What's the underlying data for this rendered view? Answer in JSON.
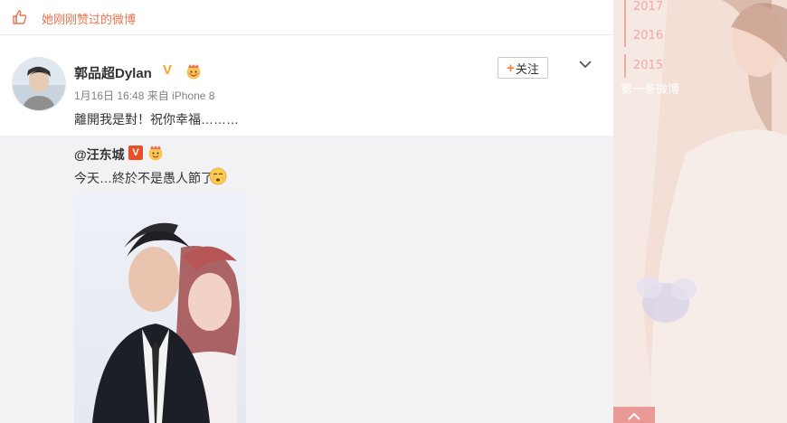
{
  "liked": {
    "text": "她刚刚赞过的微博",
    "icon": "thumbs-up-icon"
  },
  "post": {
    "username": "郭品超Dylan",
    "verified_badge": "V",
    "follow_label": "关注",
    "follow_plus": "+",
    "meta": "1月16日 16:48 来自 iPhone 8",
    "text": "離開我是對！祝你幸福………"
  },
  "repost": {
    "username": "@汪东城",
    "verified_badge": "V",
    "text": "今天…終於不是愚人節了",
    "emoji_icon": "smirk-emoji-icon"
  },
  "sidebar": {
    "years": [
      "2017",
      "2016",
      "2015"
    ],
    "first_post": "第一条微博",
    "accent": "#f1aaa0"
  },
  "colors": {
    "orange": "#eb7350",
    "gold": "#f5a623",
    "red_v": "#ea4e28"
  }
}
